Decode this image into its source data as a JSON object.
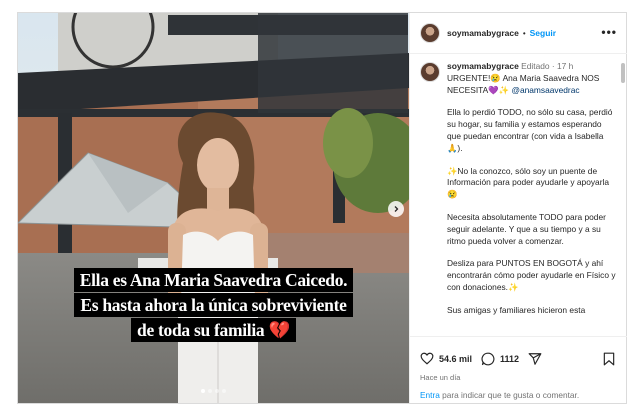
{
  "post": {
    "author": "soymamabygrace",
    "follow_label": "Seguir",
    "more_label": "•••",
    "caption": {
      "author": "soymamabygrace",
      "edited": "Editado",
      "sep": "·",
      "time": "17 h",
      "line1": "URGENTE!😢 Ana Maria Saavedra NOS NECESITA💜✨",
      "mention": "@anamsaavedrac",
      "p1": "Ella lo perdió TODO, no sólo su casa, perdió su hogar, su familia y estamos esperando que puedan encontrar (con vida a Isabella🙏).",
      "p2": "✨No la conozco, sólo soy un puente de Información para poder ayudarle y apoyarla😢",
      "p3": "Necesita absolutamente TODO para poder seguir adelante. Y que a su tiempo y a su ritmo pueda volver a comenzar.",
      "p4": "Desliza para PUNTOS EN BOGOTÁ  y ahí encontrarán cómo poder ayudarle en Físico y con donaciones.✨",
      "p5": "Sus amigas y familiares hicieron esta"
    },
    "likes": "54.6 mil",
    "comments_count": "1112",
    "time_ago": "Hace un día",
    "login_link": "Entra",
    "login_text": " para indicar que te gusta o comentar."
  },
  "media": {
    "overlay_line1": "Ella es Ana Maria Saavedra Caicedo.",
    "overlay_line2": "Es hasta ahora la única sobreviviente",
    "overlay_line3": "de toda su familia 💔",
    "carousel": {
      "total": 4,
      "active": 1
    }
  },
  "icons": {
    "avatar": "avatar",
    "next": "chevron-right-icon",
    "like": "heart-icon",
    "comment": "comment-icon",
    "share": "share-icon",
    "save": "bookmark-icon",
    "more": "more-icon"
  },
  "colors": {
    "link": "#0095f6",
    "text": "#262626",
    "muted": "#737373",
    "border": "#dbdbdb"
  }
}
